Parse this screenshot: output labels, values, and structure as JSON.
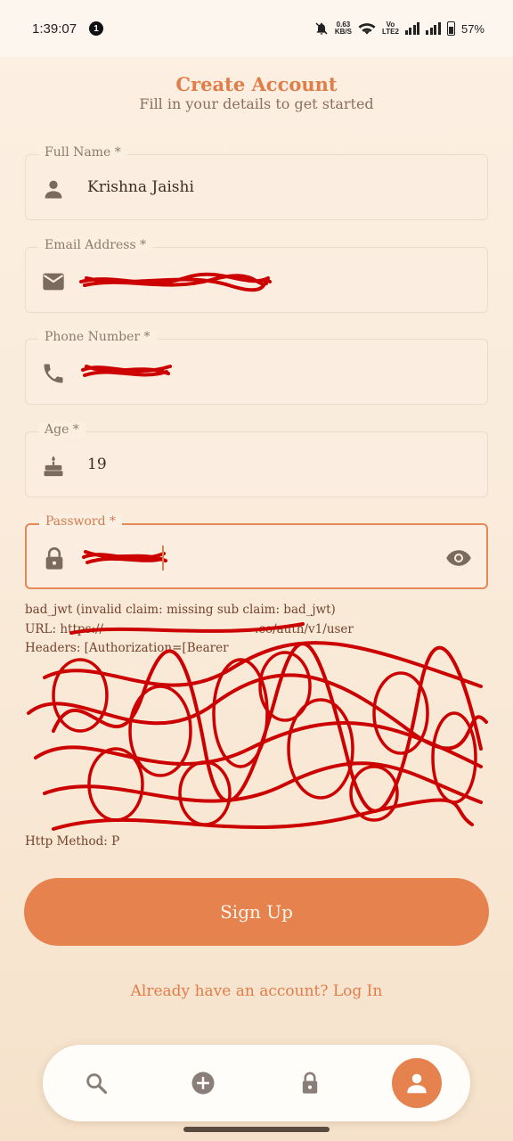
{
  "status_bar": {
    "time": "1:39:07",
    "notification_badge": "1",
    "net_speed_value": "0.63",
    "net_speed_unit": "KB/S",
    "volte_top": "Vo",
    "volte_bottom": "LTE2",
    "battery": "57%"
  },
  "header": {
    "title": "Create Account",
    "subtitle": "Fill in your details to get started"
  },
  "form": {
    "full_name": {
      "label": "Full Name *",
      "value": "Krishna Jaishi",
      "icon": "person-icon"
    },
    "email": {
      "label": "Email Address *",
      "value": "",
      "icon": "mail-icon"
    },
    "phone": {
      "label": "Phone Number *",
      "value": "",
      "icon": "phone-icon"
    },
    "age": {
      "label": "Age *",
      "value": "19",
      "icon": "cake-icon"
    },
    "password": {
      "label": "Password *",
      "value": "",
      "icon": "lock-icon",
      "toggle_icon": "eye-icon"
    }
  },
  "error": {
    "lines": [
      "bad_jwt (invalid claim: missing sub claim: bad_jwt)",
      "URL: https://",
      "Headers: [Authorization=[Bearer",
      "",
      "",
      "",
      "",
      "",
      "",
      "",
      "",
      "",
      "Http Method: P"
    ],
    "url_suffix": ".co/auth/v1/user"
  },
  "actions": {
    "signup_label": "Sign Up",
    "login_link": "Already have an account? Log In"
  },
  "colors": {
    "accent": "#e6824e",
    "title": "#e07d49",
    "background": "#fbeee0",
    "redaction": "#cc0000"
  },
  "bottom_nav": [
    {
      "icon": "search-icon",
      "active": false
    },
    {
      "icon": "add-circle-icon",
      "active": false
    },
    {
      "icon": "lock-icon",
      "active": false
    },
    {
      "icon": "account-icon",
      "active": true
    }
  ]
}
